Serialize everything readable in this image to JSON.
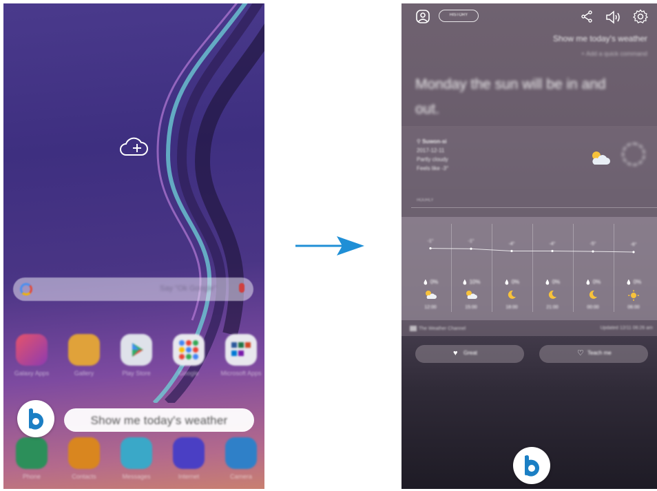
{
  "left_phone": {
    "search": {
      "hint": "Say \"Ok Google\""
    },
    "apps": [
      {
        "label": "Galaxy Apps",
        "color": "#c43a5e",
        "icon": "shopping-bag-icon"
      },
      {
        "label": "Gallery",
        "color": "#e0a23a",
        "icon": "flower-icon"
      },
      {
        "label": "Play Store",
        "color": "#dfe2ea",
        "icon": "play-store-icon"
      },
      {
        "label": "Google",
        "color": "#e8e8ee",
        "icon": "folder-icon"
      },
      {
        "label": "Microsoft Apps",
        "color": "#e8e8ee",
        "icon": "folder-icon"
      }
    ],
    "dock": [
      {
        "label": "Phone",
        "color": "#2c8f5a",
        "icon": "phone-icon"
      },
      {
        "label": "Contacts",
        "color": "#d9861f",
        "icon": "contact-icon"
      },
      {
        "label": "Messages",
        "color": "#3aa8c8",
        "icon": "message-icon"
      },
      {
        "label": "Internet",
        "color": "#4a3fc4",
        "icon": "globe-icon"
      },
      {
        "label": "Camera",
        "color": "#2f80c8",
        "icon": "camera-icon"
      }
    ],
    "utterance": "Show me today's weather"
  },
  "right_phone": {
    "history_label": "HISTORY",
    "query": "Show me today's weather",
    "add_command": "+ Add a quick command",
    "answer": "Monday the sun will be in and out.",
    "current": {
      "location": "Suwon-si",
      "date": "2017-12-11",
      "condition": "Partly cloudy",
      "feels_like": "Feels like -3°"
    },
    "hourly_label": "HOURLY",
    "hourly": [
      {
        "temp": "-1°",
        "precip": "0%",
        "time": "12:00",
        "icon": "partly-sunny-icon",
        "level": 0.68
      },
      {
        "temp": "-1°",
        "precip": "10%",
        "time": "15:00",
        "icon": "partly-sunny-icon",
        "level": 0.66
      },
      {
        "temp": "-4°",
        "precip": "0%",
        "time": "18:00",
        "icon": "moon-icon",
        "level": 0.55
      },
      {
        "temp": "-4°",
        "precip": "0%",
        "time": "21:00",
        "icon": "moon-icon",
        "level": 0.55
      },
      {
        "temp": "-5°",
        "precip": "0%",
        "time": "00:00",
        "icon": "moon-icon",
        "level": 0.53
      },
      {
        "temp": "-6°",
        "precip": "0%",
        "time": "06:00",
        "icon": "sun-icon",
        "level": 0.5
      }
    ],
    "source": "The Weather Channel",
    "updated": "Updated 12/11 06:26 am",
    "feedback": [
      {
        "label": "Great",
        "icon": "heart-filled-icon"
      },
      {
        "label": "Teach me",
        "icon": "heart-outline-icon"
      }
    ]
  },
  "colors": {
    "arrow": "#1f8fd6",
    "bixby": "#1b7fc4"
  }
}
